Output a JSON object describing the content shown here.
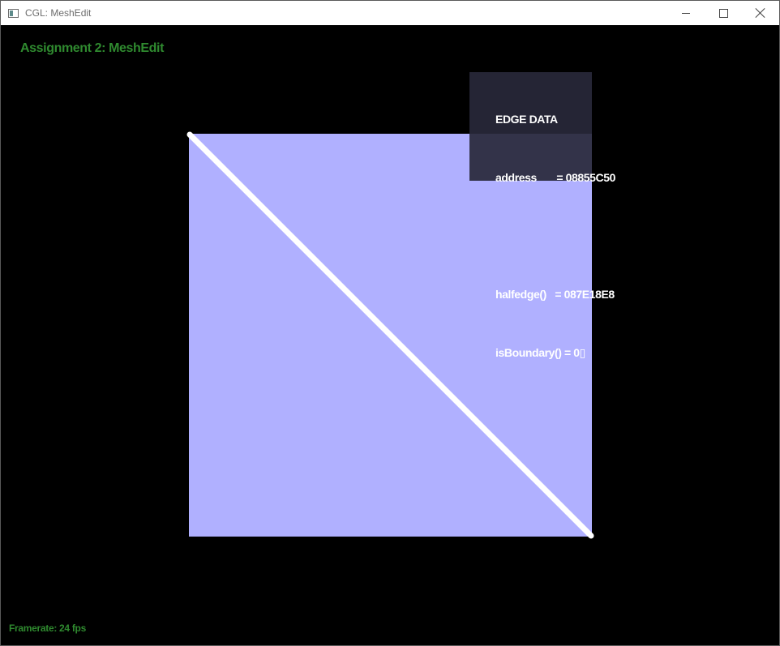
{
  "window": {
    "title": "CGL: MeshEdit",
    "controls": {
      "minimize": "minimize-icon",
      "maximize": "maximize-icon",
      "close": "close-icon"
    }
  },
  "app": {
    "heading": "Assignment 2: MeshEdit",
    "framerate": "Framerate: 24 fps"
  },
  "mesh": {
    "face_color": "#b0b0ff",
    "selected_edge_color": "#ffffff"
  },
  "edge_info": {
    "header": "EDGE DATA",
    "address": "address       = 08855C50",
    "blank": "",
    "halfedge": "halfedge()   = 087E18E8",
    "is_boundary": "isBoundary() = 0▯"
  },
  "colors": {
    "heading_green": "#2f8a2f",
    "background": "#000000"
  }
}
